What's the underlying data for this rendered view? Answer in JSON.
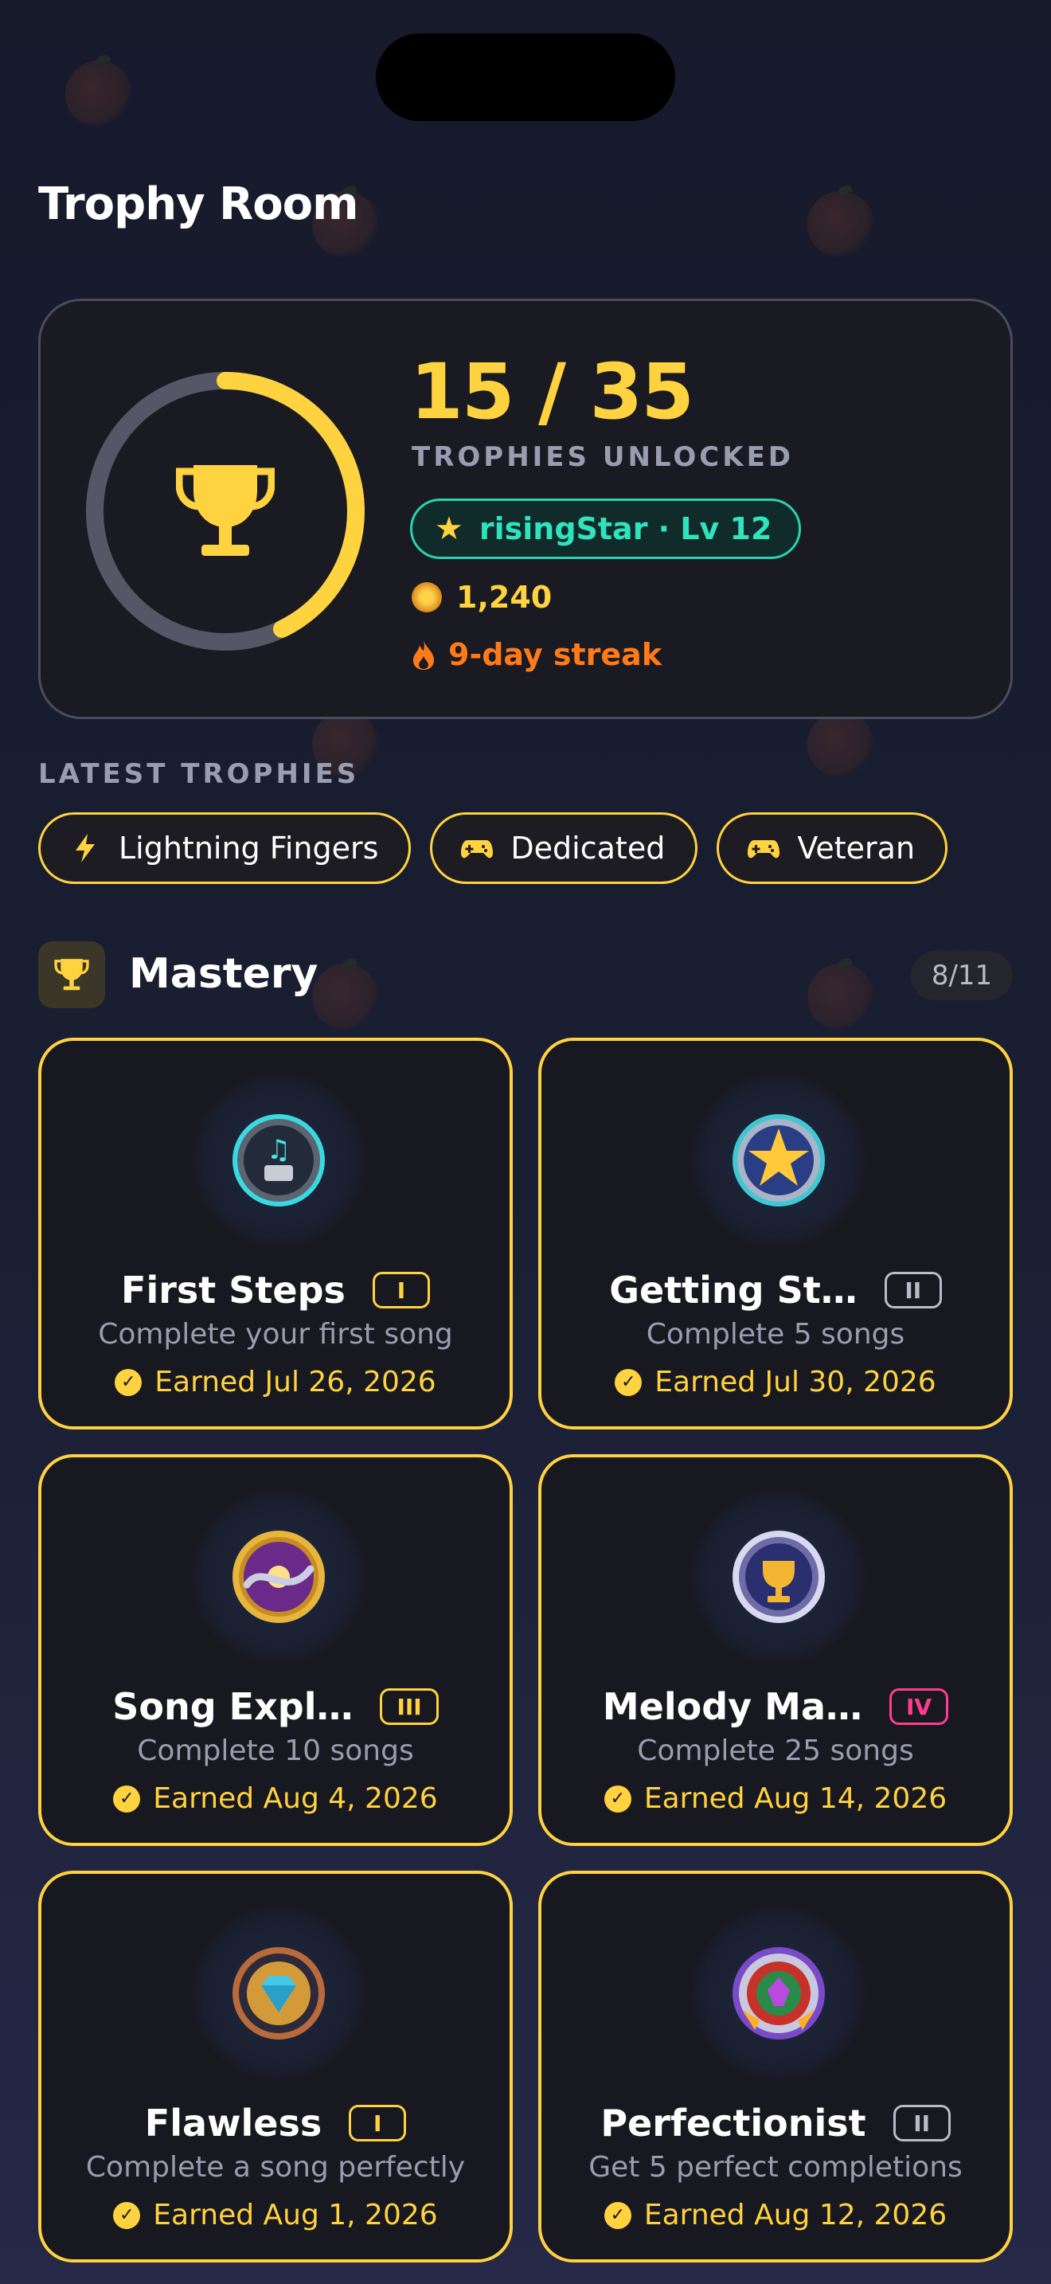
{
  "app": {
    "title": "Trophy Room"
  },
  "summary": {
    "unlocked": "15 / 35",
    "unlocked_fraction": 0.4286,
    "label": "TROPHIES UNLOCKED",
    "user": "risingStar · Lv 12",
    "coins": "1,240",
    "streak": "9-day streak"
  },
  "latest": {
    "label": "LATEST TROPHIES",
    "items": [
      {
        "label": "Lightning Fingers",
        "icon": "lightning-icon"
      },
      {
        "label": "Dedicated",
        "icon": "gamepad-icon"
      },
      {
        "label": "Veteran",
        "icon": "gamepad-icon"
      }
    ]
  },
  "section": {
    "title": "Mastery",
    "count": "8/11"
  },
  "cards": [
    {
      "name": "First Steps",
      "tier": "I",
      "desc": "Complete your first song",
      "earned": "Earned Jul 26, 2026",
      "icon": "music-box-medal-icon"
    },
    {
      "name": "Getting St…",
      "tier": "II",
      "desc": "Complete 5 songs",
      "earned": "Earned Jul 30, 2026",
      "icon": "star-medal-icon"
    },
    {
      "name": "Song Expl…",
      "tier": "III",
      "desc": "Complete 10 songs",
      "earned": "Earned Aug 4, 2026",
      "icon": "dragon-medal-icon"
    },
    {
      "name": "Melody Ma…",
      "tier": "IV",
      "desc": "Complete 25 songs",
      "earned": "Earned Aug 14, 2026",
      "icon": "trophy-medal-icon"
    },
    {
      "name": "Flawless",
      "tier": "I",
      "desc": "Complete a song perfectly",
      "earned": "Earned Aug 1, 2026",
      "icon": "diamond-medal-icon"
    },
    {
      "name": "Perfectionist",
      "tier": "II",
      "desc": "Get 5 perfect completions",
      "earned": "Earned Aug 12, 2026",
      "icon": "gem-rosette-medal-icon"
    }
  ],
  "colors": {
    "accent": "#ffd23f",
    "teal": "#2fe3bd",
    "orange": "#ff7a18",
    "pink": "#ff3d8f"
  }
}
